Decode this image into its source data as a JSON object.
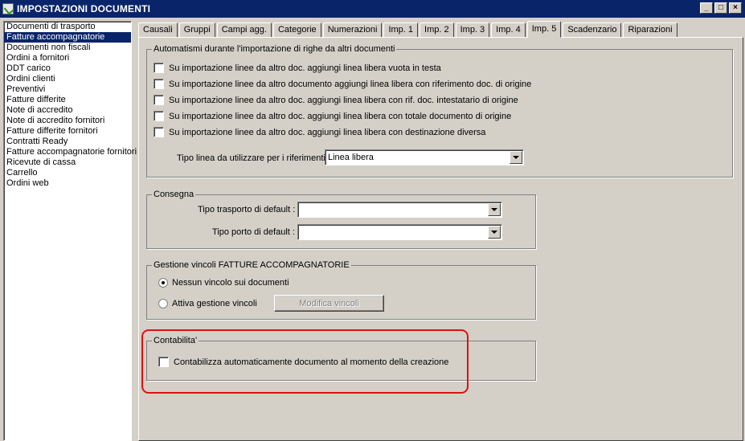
{
  "window": {
    "title": "IMPOSTAZIONI DOCUMENTI",
    "buttons": [
      "_",
      "□",
      "×"
    ]
  },
  "documents": {
    "selected_index": 1,
    "items": [
      "Documenti di trasporto",
      "Fatture accompagnatorie",
      "Documenti non fiscali",
      "Ordini a fornitori",
      "DDT carico",
      "Ordini clienti",
      "Preventivi",
      "Fatture differite",
      "Note di accredito",
      "Note di accredito fornitori",
      "Fatture differite fornitori",
      "Contratti Ready",
      "Fatture accompagnatorie fornitori",
      "Ricevute di cassa",
      "Carrello",
      "Ordini web"
    ]
  },
  "tabs": {
    "active": "Imp. 5",
    "items": [
      "Causali",
      "Gruppi",
      "Campi agg.",
      "Categorie",
      "Numerazioni",
      "Imp. 1",
      "Imp. 2",
      "Imp. 3",
      "Imp. 4",
      "Imp. 5",
      "Scadenzario",
      "Riparazioni"
    ]
  },
  "automatismi": {
    "legend": "Automatismi durante l'importazione di righe da altri documenti",
    "options": [
      {
        "label": "Su importazione linee da altro doc. aggiungi linea libera vuota in testa",
        "checked": false
      },
      {
        "label": "Su importazione linee da altro documento aggiungi linea libera con riferimento doc. di origine",
        "checked": false
      },
      {
        "label": "Su importazione linee da altro doc. aggiungi linea libera con rif. doc. intestatario di origine",
        "checked": false
      },
      {
        "label": "Su importazione linee da altro doc. aggiungi linea libera con totale documento di origine",
        "checked": false
      },
      {
        "label": "Su importazione linee da altro doc. aggiungi linea libera con destinazione diversa",
        "checked": false
      }
    ],
    "tipo_linea_label": "Tipo linea da utilizzare per i riferimenti :",
    "tipo_linea_value": "Linea libera"
  },
  "consegna": {
    "legend": "Consegna",
    "trasporto_label": "Tipo trasporto di default :",
    "trasporto_value": "",
    "porto_label": "Tipo porto di default :",
    "porto_value": ""
  },
  "vincoli": {
    "legend": "Gestione vincoli FATTURE ACCOMPAGNATORIE",
    "option_none": "Nessun vincolo sui documenti",
    "option_active": "Attiva gestione vincoli",
    "selected": "none",
    "modify_button": "Modifica vincoli"
  },
  "contabilita": {
    "legend": "Contabilita'",
    "option": "Contabilizza automaticamente documento al momento della creazione",
    "checked": false,
    "highlight_color": "#e01010"
  }
}
